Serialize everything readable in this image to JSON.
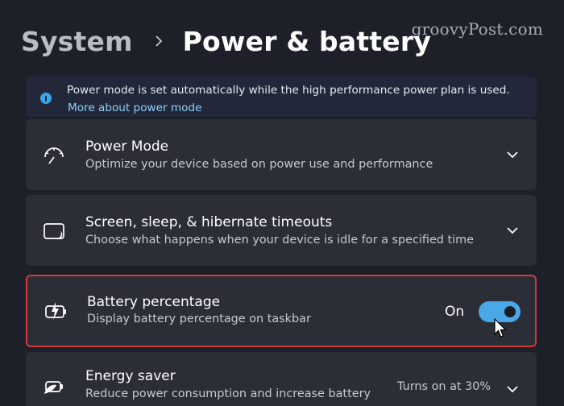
{
  "watermark": "groovyPost.com",
  "header": {
    "parent": "System",
    "current": "Power & battery"
  },
  "info": {
    "text": "Power mode is set automatically while the high performance power plan is used.",
    "link": "More about power mode"
  },
  "cards": {
    "power_mode": {
      "title": "Power Mode",
      "description": "Optimize your device based on power use and performance"
    },
    "screen_sleep": {
      "title": "Screen, sleep, & hibernate timeouts",
      "description": "Choose what happens when your device is idle for a specified time"
    },
    "battery_percentage": {
      "title": "Battery percentage",
      "description": "Display battery percentage on taskbar",
      "toggle_label": "On"
    },
    "energy_saver": {
      "title": "Energy saver",
      "description": "Reduce power consumption and increase battery",
      "status": "Turns on at 30%"
    }
  },
  "colors": {
    "accent": "#4aa8e8",
    "highlight": "#d23a3a",
    "link": "#8fd0f7"
  },
  "icons": [
    "info-icon",
    "speedometer-icon",
    "screen-sleep-icon",
    "battery-charging-icon",
    "energy-saver-icon",
    "chevron-down-icon",
    "chevron-right-icon",
    "mouse-cursor-icon"
  ]
}
